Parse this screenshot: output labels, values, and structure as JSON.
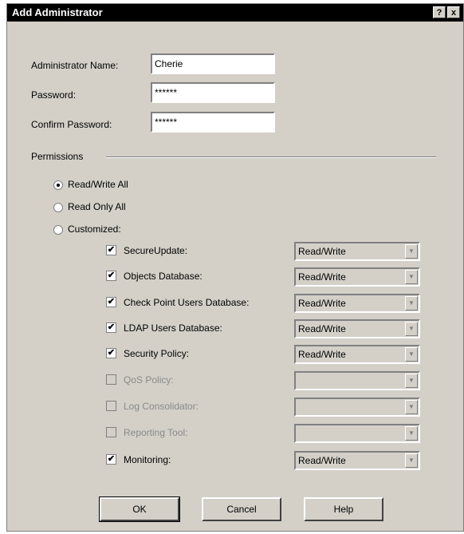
{
  "window": {
    "title": "Add Administrator",
    "help_glyph": "?",
    "close_glyph": "x"
  },
  "form": {
    "name_label": "Administrator Name:",
    "name_value": "Cherie",
    "password_label": "Password:",
    "password_value": "******",
    "confirm_label": "Confirm Password:",
    "confirm_value": "******"
  },
  "permissions": {
    "group_label": "Permissions",
    "radios": [
      {
        "label": "Read/Write All",
        "checked": true
      },
      {
        "label": "Read Only All",
        "checked": false
      },
      {
        "label": "Customized:",
        "checked": false
      }
    ],
    "items": [
      {
        "label": "SecureUpdate:",
        "checked": true,
        "enabled": true,
        "value": "Read/Write"
      },
      {
        "label": "Objects Database:",
        "checked": true,
        "enabled": true,
        "value": "Read/Write"
      },
      {
        "label": "Check Point Users Database:",
        "checked": true,
        "enabled": true,
        "value": "Read/Write"
      },
      {
        "label": "LDAP Users Database:",
        "checked": true,
        "enabled": true,
        "value": "Read/Write"
      },
      {
        "label": "Security Policy:",
        "checked": true,
        "enabled": true,
        "value": "Read/Write"
      },
      {
        "label": "QoS Policy:",
        "checked": false,
        "enabled": false,
        "value": ""
      },
      {
        "label": "Log Consolidator:",
        "checked": false,
        "enabled": false,
        "value": ""
      },
      {
        "label": "Reporting Tool:",
        "checked": false,
        "enabled": false,
        "value": ""
      },
      {
        "label": "Monitoring:",
        "checked": true,
        "enabled": true,
        "value": "Read/Write"
      }
    ],
    "checkmark_glyph": "✔",
    "dropdown_glyph": "▼"
  },
  "buttons": {
    "ok": "OK",
    "cancel": "Cancel",
    "help": "Help"
  }
}
